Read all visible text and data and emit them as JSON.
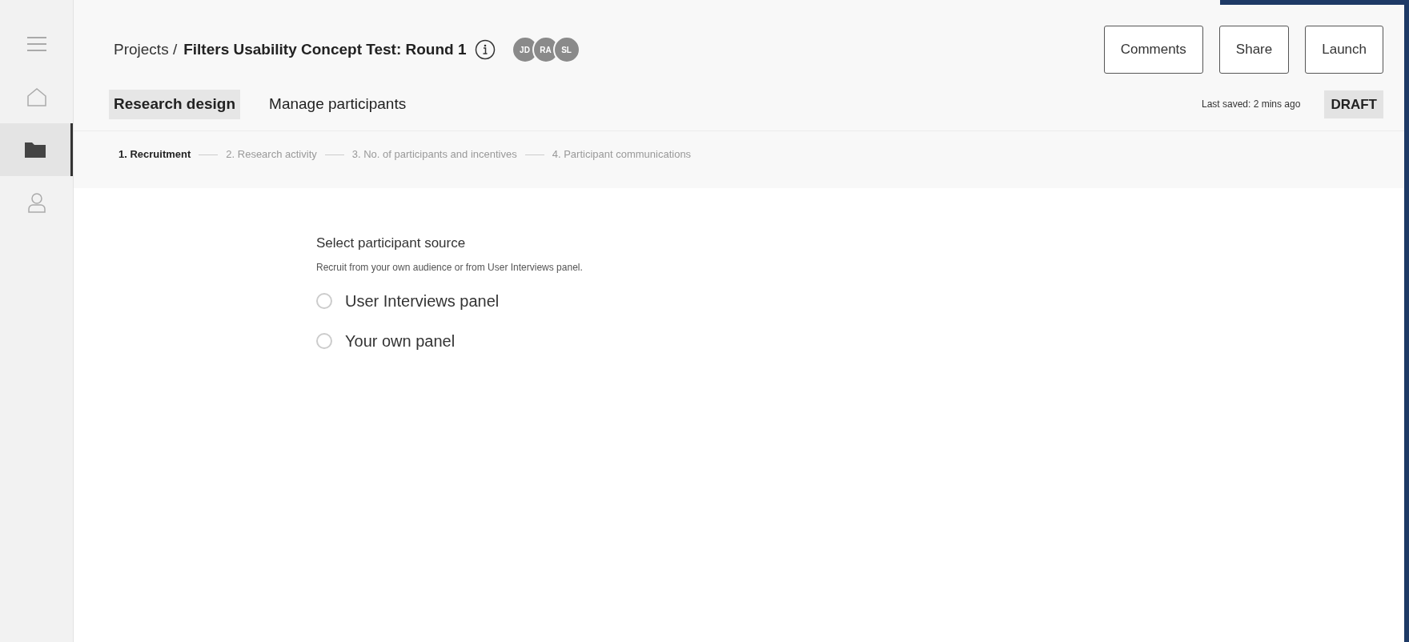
{
  "sidebar": {
    "items": [
      {
        "kind": "menu",
        "selected": false
      },
      {
        "kind": "home",
        "selected": false
      },
      {
        "kind": "folder",
        "selected": true
      },
      {
        "kind": "user",
        "selected": false
      }
    ]
  },
  "breadcrumb": {
    "parent": "Projects /",
    "title": "Filters Usability Concept Test: Round 1"
  },
  "avatars": [
    "JD",
    "RA",
    "SL"
  ],
  "buttons": [
    "Comments",
    "Share",
    "Launch"
  ],
  "tabs": [
    {
      "label": "Research design",
      "selected": true
    },
    {
      "label": "Manage participants",
      "selected": false
    }
  ],
  "last_saved": "Last saved: 2 mins ago",
  "status_badge": "DRAFT",
  "steps": [
    {
      "label": "1. Recruitment",
      "selected": true
    },
    {
      "label": "2. Research activity",
      "selected": false
    },
    {
      "label": "3. No. of participants and incentives",
      "selected": false
    },
    {
      "label": "4. Participant communications",
      "selected": false
    }
  ],
  "section": {
    "title": "Select participant source",
    "description": "Recruit from your own audience or from User Interviews panel.",
    "options": [
      {
        "label": "User Interviews panel",
        "checked": false
      },
      {
        "label": "Your own panel",
        "checked": false
      }
    ]
  }
}
